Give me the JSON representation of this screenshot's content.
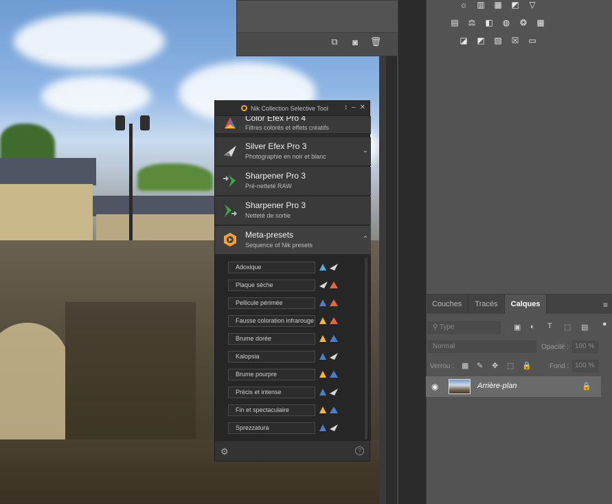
{
  "nik_panel": {
    "title": "Nik Collection Selective Tool",
    "products": [
      {
        "name": "Color Efex Pro 4",
        "subtitle": "Filtres colorés et effets créatifs"
      },
      {
        "name": "Silver Efex Pro 3",
        "subtitle": "Photographie en noir et blanc"
      },
      {
        "name": "Sharpener Pro 3",
        "subtitle": "Pré-netteté RAW"
      },
      {
        "name": "Sharpener Pro 3",
        "subtitle": "Netteté de sortie"
      },
      {
        "name": "Meta-presets",
        "subtitle": "Sequence of Nik presets"
      }
    ],
    "presets": [
      "Adoxique",
      "Plaque sèche",
      "Pellicule périmée",
      "Fausse coloration infrarouge",
      "Brume dorée",
      "Kalopsia",
      "Brume pourpre",
      "Précis et intense",
      "Fin et spectaculaire",
      "Sprezzatura"
    ],
    "help": "?"
  },
  "layers_panel": {
    "tabs": [
      "Couches",
      "Tracés",
      "Calques"
    ],
    "active_tab": "Calques",
    "filter_placeholder": "Type",
    "blend_mode": "Normal",
    "opacity_label": "Opacité :",
    "opacity_value": "100 %",
    "lock_label": "Verrou :",
    "fill_label": "Fond :",
    "fill_value": "100 %",
    "layer_name": "Arrière-plan"
  },
  "colors": {
    "accent_orange": "#f3a233",
    "panel_bg": "#535353",
    "nik_bg": "#2b2b2b"
  }
}
